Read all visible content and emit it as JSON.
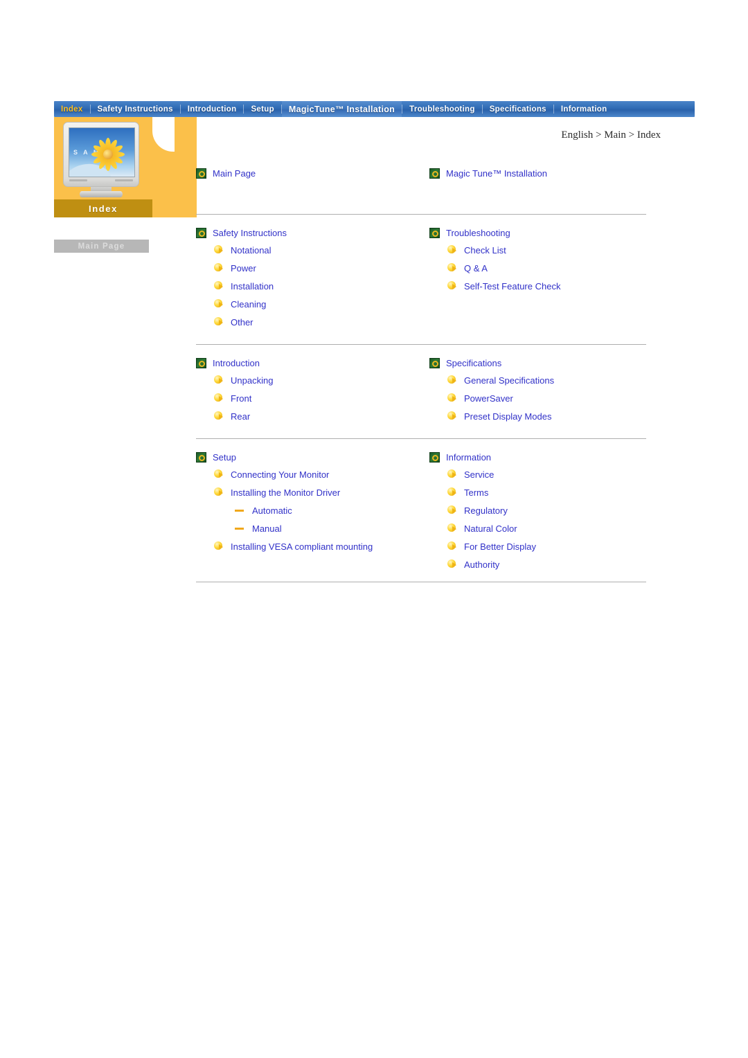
{
  "nav": {
    "items": [
      {
        "label": "Index",
        "active": true,
        "emphasis": false
      },
      {
        "label": "Safety Instructions",
        "active": false,
        "emphasis": false
      },
      {
        "label": "Introduction",
        "active": false,
        "emphasis": false
      },
      {
        "label": "Setup",
        "active": false,
        "emphasis": false
      },
      {
        "label": "MagicTune™ Installation",
        "active": false,
        "emphasis": true
      },
      {
        "label": "Troubleshooting",
        "active": false,
        "emphasis": false
      },
      {
        "label": "Specifications",
        "active": false,
        "emphasis": false
      },
      {
        "label": "Information",
        "active": false,
        "emphasis": false
      }
    ]
  },
  "sidebar": {
    "panel_label": "Index",
    "monitor_brand_text": "S A M",
    "main_page_button": "Main Page"
  },
  "breadcrumb": "English > Main > Index",
  "top_links": {
    "left": "Main Page",
    "right": "Magic Tune™ Installation"
  },
  "sections": {
    "safety": {
      "title": "Safety Instructions",
      "items": [
        "Notational",
        "Power",
        "Installation",
        "Cleaning",
        "Other"
      ]
    },
    "troubleshooting": {
      "title": "Troubleshooting",
      "items": [
        "Check List",
        "Q & A",
        "Self-Test Feature Check"
      ]
    },
    "introduction": {
      "title": "Introduction",
      "items": [
        "Unpacking",
        "Front",
        "Rear"
      ]
    },
    "specifications": {
      "title": "Specifications",
      "items": [
        "General Specifications",
        "PowerSaver",
        "Preset Display Modes"
      ]
    },
    "setup": {
      "title": "Setup",
      "item1": "Connecting Your Monitor",
      "item2": "Installing the Monitor Driver",
      "item2_sub": [
        "Automatic",
        "Manual"
      ],
      "item3": "Installing VESA compliant mounting"
    },
    "information": {
      "title": "Information",
      "items": [
        "Service",
        "Terms",
        "Regulatory",
        "Natural Color",
        "For Better Display",
        "Authority"
      ]
    }
  },
  "colors": {
    "link": "#3131c8",
    "nav_active": "#ffbf1f",
    "panel_orange": "#fbc04a",
    "index_bar": "#bf8f12",
    "bullet_green": "#2f7a36",
    "bullet_gold": "#ffd93a",
    "divider": "#aeaeae"
  }
}
